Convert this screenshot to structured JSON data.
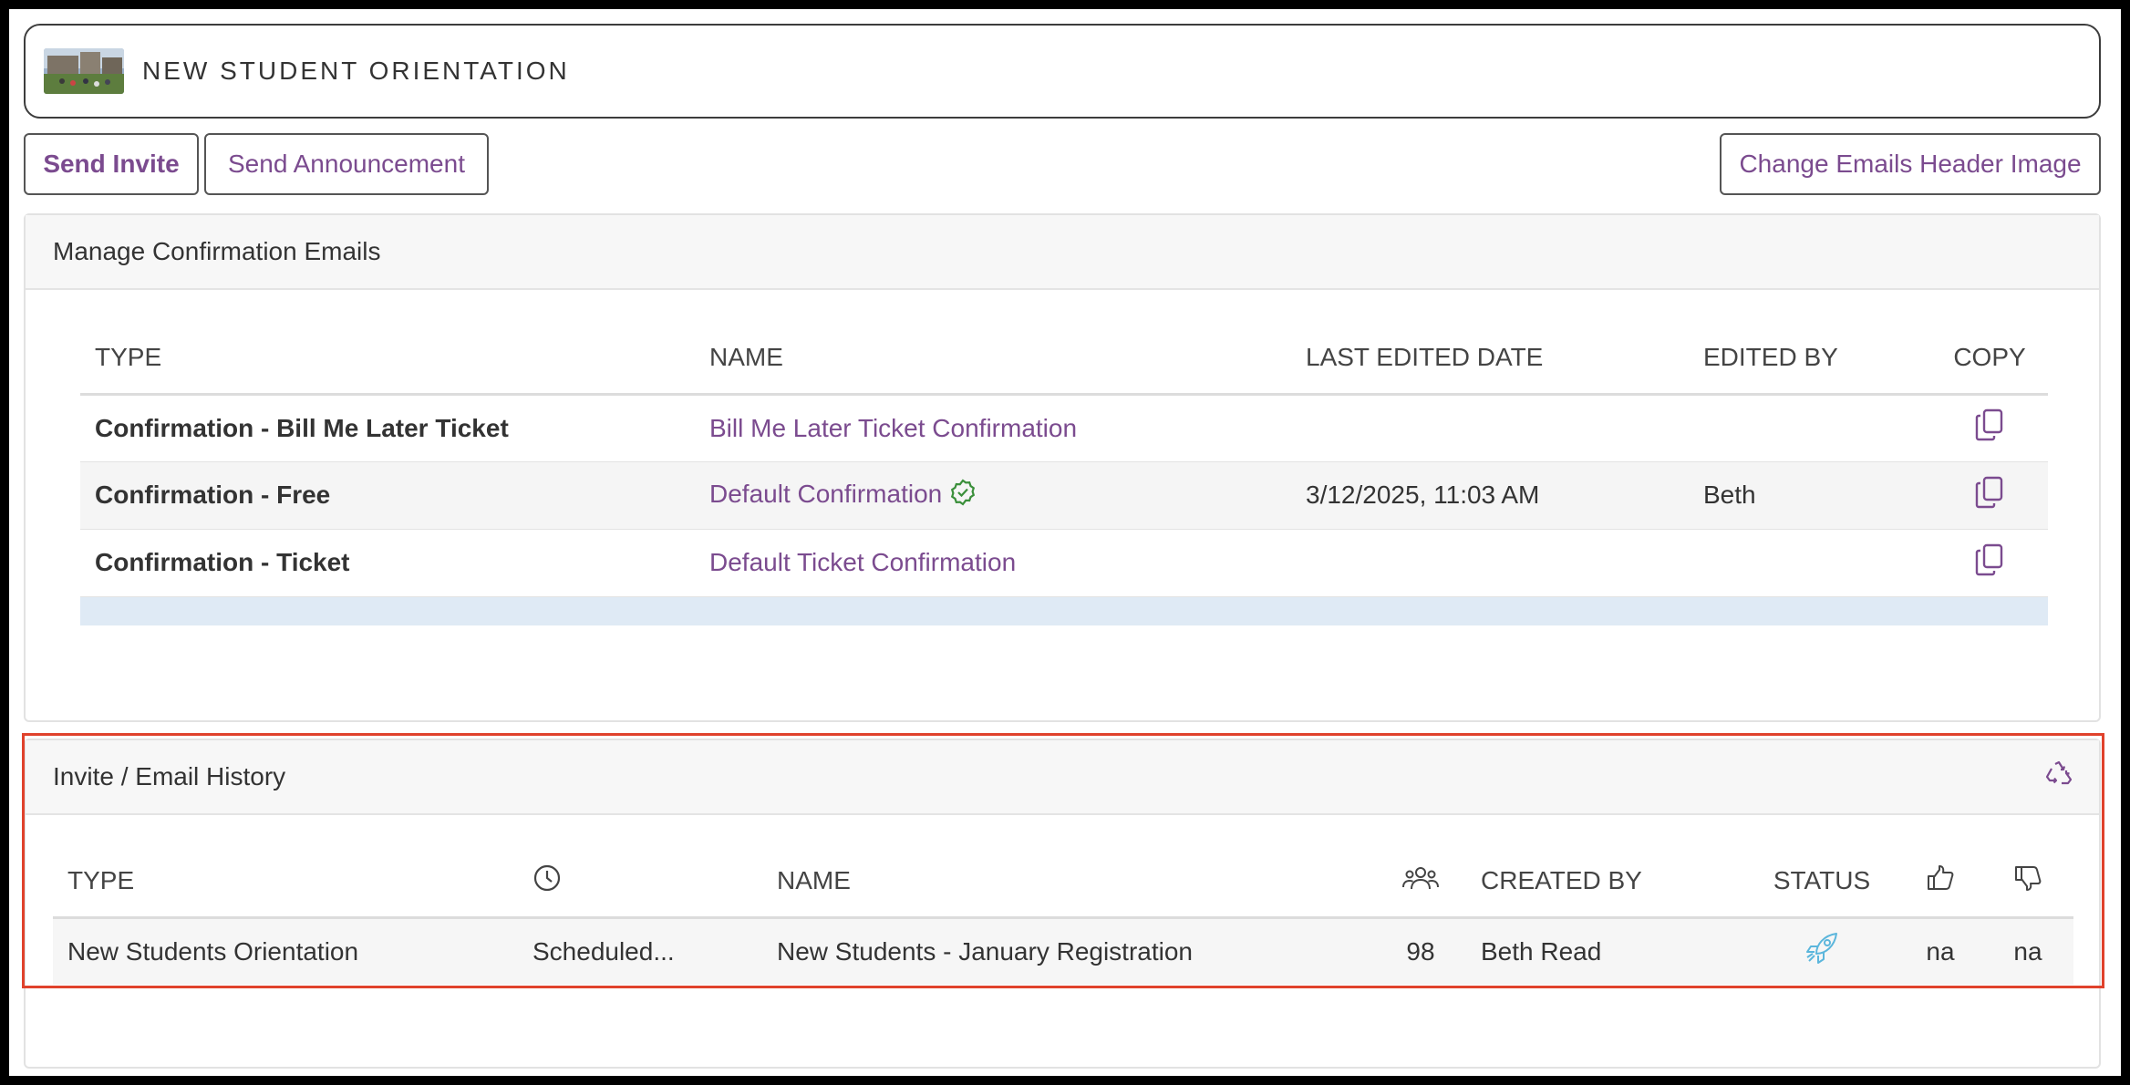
{
  "header": {
    "title": "NEW STUDENT ORIENTATION"
  },
  "toolbar": {
    "send_invite": "Send Invite",
    "send_announcement": "Send Announcement",
    "change_header_image": "Change Emails Header Image"
  },
  "confirmation": {
    "title": "Manage Confirmation Emails",
    "columns": {
      "type": "TYPE",
      "name": "NAME",
      "last_edited": "LAST EDITED DATE",
      "edited_by": "EDITED BY",
      "copy": "COPY"
    },
    "rows": [
      {
        "type": "Confirmation - Bill Me Later Ticket",
        "name": "Bill Me Later Ticket Confirmation",
        "last_edited": "",
        "edited_by": "",
        "default": false
      },
      {
        "type": "Confirmation - Free",
        "name": "Default Confirmation",
        "last_edited": "3/12/2025, 11:03 AM",
        "edited_by": "Beth",
        "default": true
      },
      {
        "type": "Confirmation - Ticket",
        "name": "Default Ticket Confirmation",
        "last_edited": "",
        "edited_by": "",
        "default": false
      }
    ]
  },
  "history": {
    "title": "Invite / Email History",
    "columns": {
      "type": "TYPE",
      "name": "NAME",
      "created_by": "CREATED BY",
      "status": "STATUS"
    },
    "rows": [
      {
        "type": "New Students Orientation",
        "schedule": "Scheduled...",
        "name": "New Students - January Registration",
        "recipients": "98",
        "created_by": "Beth Read",
        "status_icon": "rocket-icon",
        "likes": "na",
        "dislikes": "na"
      }
    ]
  },
  "colors": {
    "accent": "#7b4b8f",
    "highlight_border": "#e0422c",
    "status_icon": "#5bb6dc",
    "check": "#3a8f3a"
  }
}
